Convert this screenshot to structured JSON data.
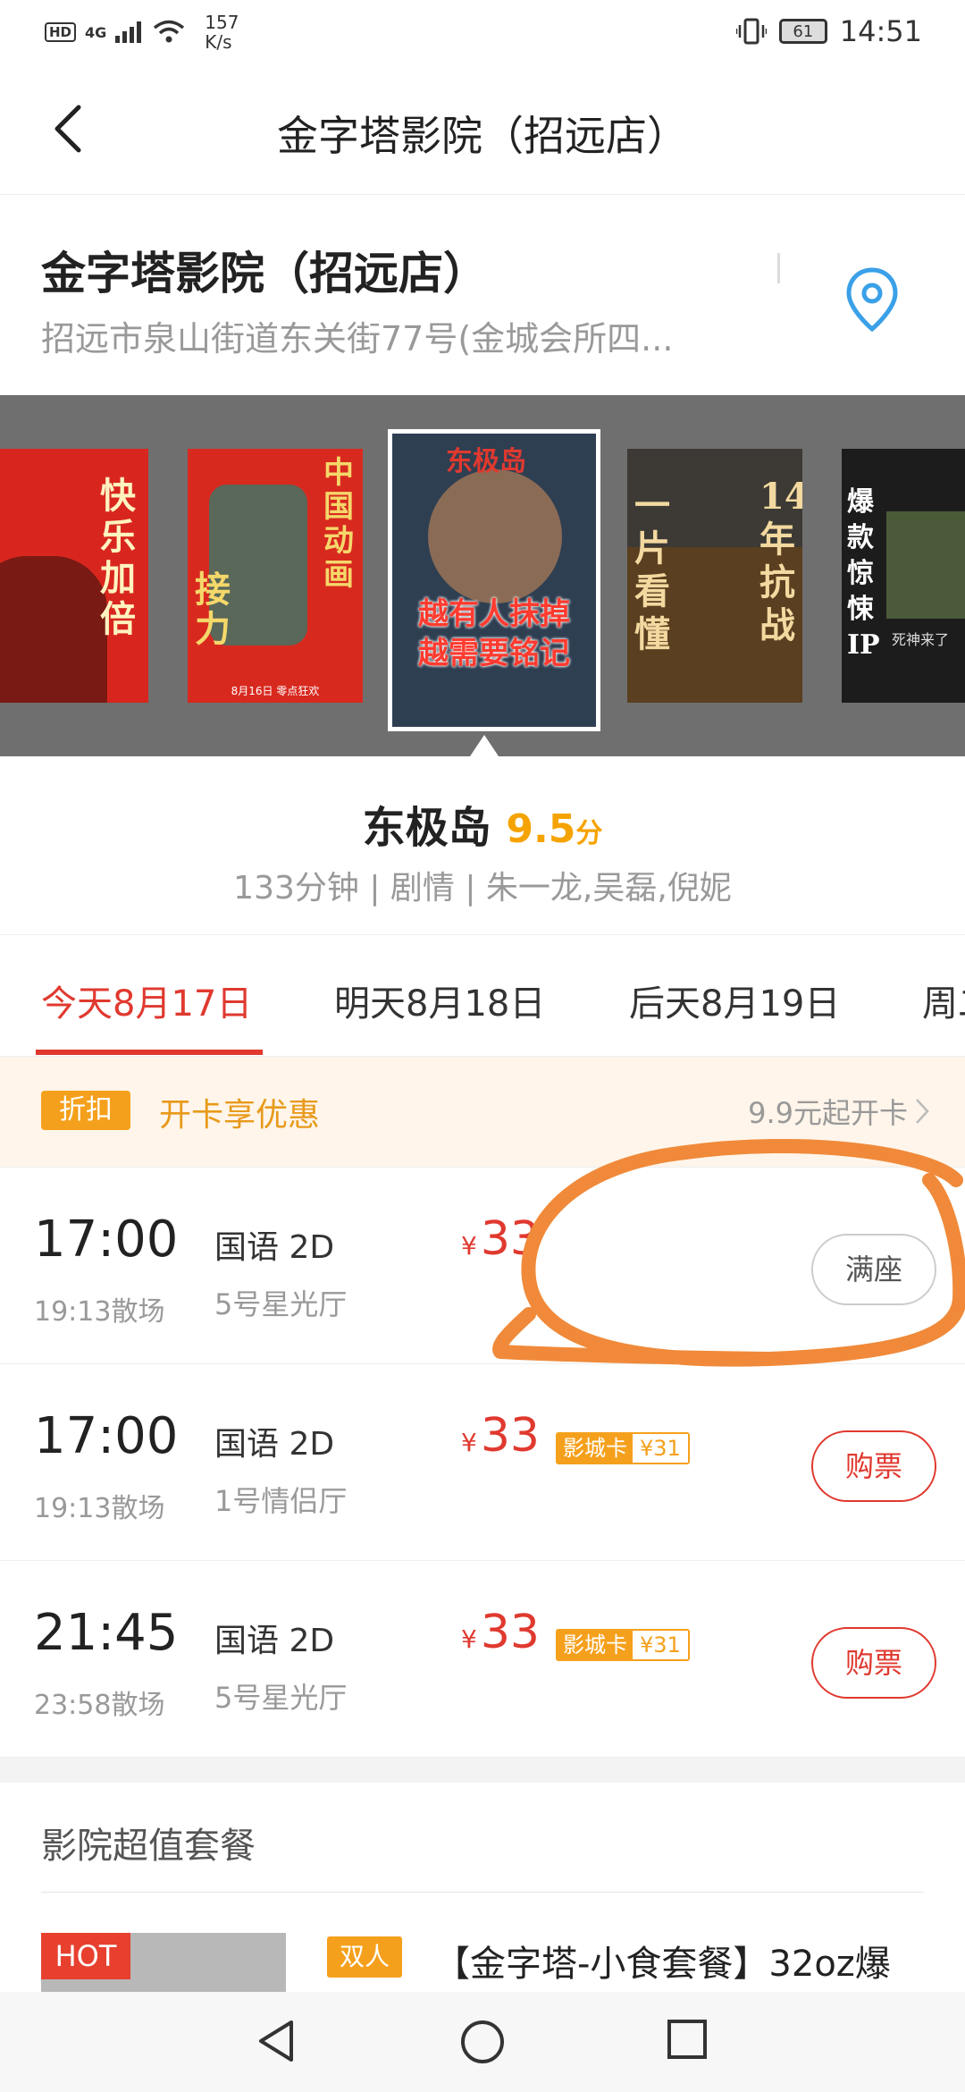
{
  "status_bar": {
    "hd": "HD",
    "network": "4G",
    "speed_value": "157",
    "speed_unit": "K/s",
    "battery": "61",
    "time": "14:51"
  },
  "header": {
    "title": "金字塔影院（招远店）"
  },
  "cinema": {
    "name": "金字塔影院（招远店）",
    "address": "招远市泉山街道东关街77号(金城会所四..."
  },
  "posters": [
    {
      "lines": [
        "快",
        "乐",
        "加",
        "倍"
      ],
      "bg": "#d8261e"
    },
    {
      "lines": [
        "中国动画",
        "接力"
      ],
      "caption": "8月16日 零点狂欢",
      "bg": "#d8291f"
    },
    {
      "lines": [
        "越有人抹掉",
        "越需要铭记"
      ],
      "logo": "东极岛",
      "bg": "#2f3f52"
    },
    {
      "lines": [
        "一片看懂",
        "14年抗战"
      ],
      "bg": "#5a3f20"
    },
    {
      "lines": [
        "爆款惊悚IP"
      ],
      "caption": "死神来了",
      "bg": "#1c1c1c"
    }
  ],
  "movie": {
    "title": "东极岛",
    "score": "9.5",
    "score_unit": "分",
    "meta": "133分钟 | 剧情 | 朱一龙,吴磊,倪妮"
  },
  "tabs": [
    {
      "label": "今天8月17日",
      "active": true
    },
    {
      "label": "明天8月18日",
      "active": false
    },
    {
      "label": "后天8月19日",
      "active": false
    },
    {
      "label": "周二",
      "active": false
    }
  ],
  "promo": {
    "badge": "折扣",
    "text": "开卡享优惠",
    "right": "9.9元起开卡"
  },
  "showtimes": [
    {
      "time": "17:00",
      "end": "19:13散场",
      "lang": "国语 2D",
      "hall": "5号星光厅",
      "currency": "¥",
      "price": "33",
      "card_label": "",
      "card_price": "",
      "button": "满座",
      "status": "full"
    },
    {
      "time": "17:00",
      "end": "19:13散场",
      "lang": "国语 2D",
      "hall": "1号情侣厅",
      "currency": "¥",
      "price": "33",
      "card_label": "影城卡",
      "card_price": "¥31",
      "button": "购票",
      "status": "buy"
    },
    {
      "time": "21:45",
      "end": "23:58散场",
      "lang": "国语 2D",
      "hall": "5号星光厅",
      "currency": "¥",
      "price": "33",
      "card_label": "影城卡",
      "card_price": "¥31",
      "button": "购票",
      "status": "buy"
    }
  ],
  "combo": {
    "section_title": "影院超值套餐",
    "hot": "HOT",
    "tag": "双人",
    "name": "【金字塔-小食套餐】32oz爆"
  },
  "colors": {
    "accent": "#e0392f",
    "orange": "#f5a01c",
    "score": "#f5a300",
    "annotation": "#f08a3a"
  }
}
